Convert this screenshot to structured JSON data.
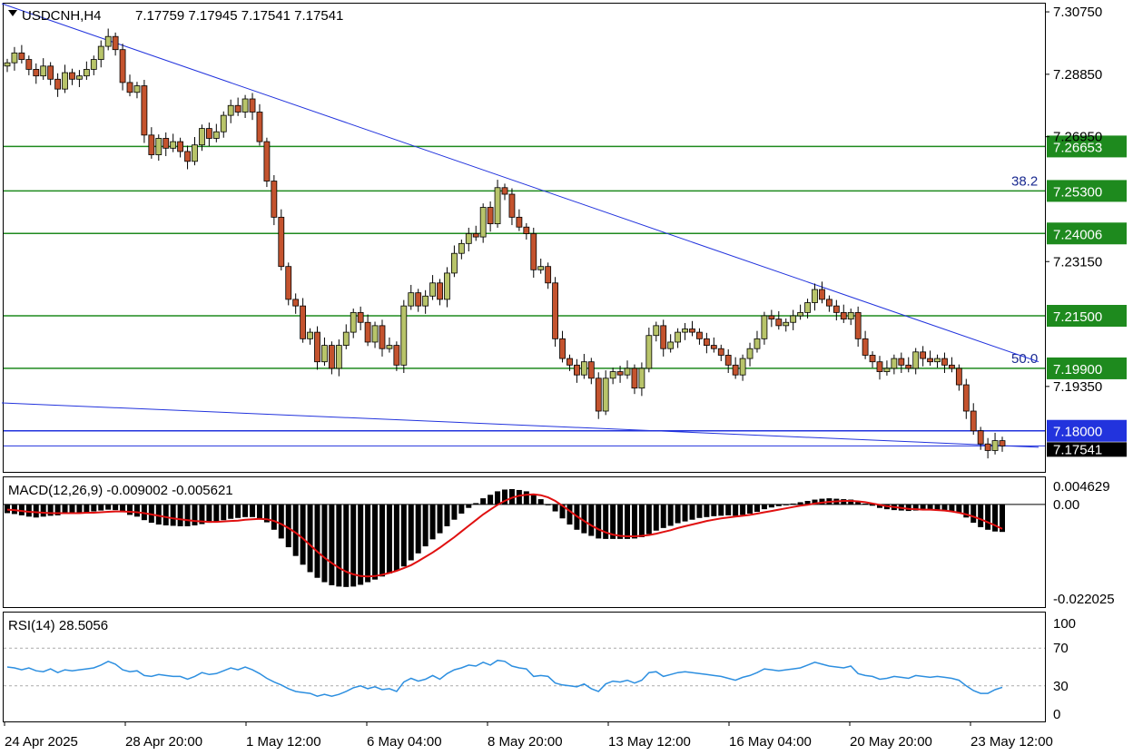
{
  "header": {
    "symbol_label": "USDCNH,H4",
    "ohlc": "7.17759 7.17945 7.17541 7.17541",
    "colors": {
      "bull": "#b8c46a",
      "bear": "#c4532e",
      "level": "#1e8a1e",
      "trend": "#2233dd",
      "macd_signal": "#e01010",
      "rsi": "#2d8fe0"
    }
  },
  "chart_data": [
    {
      "type": "candlestick",
      "title": "USDCNH,H4",
      "ylim": [
        7.1675,
        7.31
      ],
      "y_ticks": [
        "7.30750",
        "7.28850",
        "7.26950",
        "7.23150",
        "7.19350"
      ],
      "x_ticks": [
        "24 Apr 2025",
        "28 Apr 20:00",
        "1 May 12:00",
        "6 May 04:00",
        "8 May 20:00",
        "13 May 12:00",
        "16 May 04:00",
        "20 May 20:00",
        "23 May 12:00"
      ],
      "price_tag": "7.17541",
      "levels": [
        {
          "value": 7.26653,
          "label": "7.26653"
        },
        {
          "value": 7.253,
          "label": "7.25300",
          "fib": "38.2"
        },
        {
          "value": 7.24006,
          "label": "7.24006"
        },
        {
          "value": 7.215,
          "label": "7.21500"
        },
        {
          "value": 7.199,
          "label": "7.19900",
          "fib": "50.0"
        },
        {
          "value": 7.18,
          "label": "7.18000"
        }
      ],
      "trendlines": [
        {
          "from": [
            0,
            7.31
          ],
          "to": [
            138,
            7.201
          ]
        },
        {
          "from": [
            0,
            7.1885
          ],
          "to": [
            138,
            7.175
          ]
        }
      ],
      "candles_close": [
        7.292,
        7.295,
        7.293,
        7.29,
        7.288,
        7.291,
        7.287,
        7.284,
        7.289,
        7.287,
        7.288,
        7.29,
        7.293,
        7.297,
        7.3,
        7.296,
        7.286,
        7.283,
        7.285,
        7.27,
        7.264,
        7.269,
        7.266,
        7.268,
        7.265,
        7.262,
        7.267,
        7.272,
        7.269,
        7.271,
        7.276,
        7.279,
        7.277,
        7.281,
        7.277,
        7.268,
        7.256,
        7.245,
        7.23,
        7.22,
        7.218,
        7.208,
        7.21,
        7.201,
        7.206,
        7.199,
        7.206,
        7.21,
        7.216,
        7.213,
        7.207,
        7.212,
        7.205,
        7.206,
        7.2,
        7.218,
        7.222,
        7.218,
        7.221,
        7.225,
        7.22,
        7.228,
        7.234,
        7.237,
        7.24,
        7.239,
        7.248,
        7.243,
        7.254,
        7.252,
        7.245,
        7.242,
        7.24,
        7.229,
        7.23,
        7.225,
        7.208,
        7.202,
        7.2,
        7.197,
        7.201,
        7.196,
        7.186,
        7.196,
        7.198,
        7.197,
        7.199,
        7.193,
        7.199,
        7.209,
        7.212,
        7.205,
        7.207,
        7.21,
        7.211,
        7.21,
        7.208,
        7.206,
        7.205,
        7.203,
        7.2,
        7.197,
        7.202,
        7.205,
        7.208,
        7.215,
        7.214,
        7.212,
        7.213,
        7.215,
        7.216,
        7.219,
        7.223,
        7.22,
        7.218,
        7.216,
        7.214,
        7.216,
        7.208,
        7.203,
        7.201,
        7.198,
        7.199,
        7.202,
        7.2,
        7.199,
        7.204,
        7.202,
        7.201,
        7.202,
        7.2,
        7.199,
        7.194,
        7.186,
        7.18,
        7.176,
        7.174,
        7.177,
        7.1754
      ]
    },
    {
      "type": "bar",
      "title": "MACD(12,26,9) -0.009002 -0.005621",
      "ylim": [
        -0.0235,
        0.0062
      ],
      "y_ticks": [
        "0.004629",
        "0.00",
        "-0.022025"
      ],
      "series": [
        {
          "name": "MACD",
          "values": [
            -0.002,
            -0.0022,
            -0.0025,
            -0.0028,
            -0.003,
            -0.0028,
            -0.0026,
            -0.0025,
            -0.0022,
            -0.002,
            -0.0019,
            -0.0018,
            -0.0016,
            -0.0014,
            -0.0012,
            -0.0013,
            -0.0018,
            -0.0024,
            -0.0028,
            -0.0036,
            -0.0042,
            -0.0046,
            -0.0048,
            -0.0049,
            -0.005,
            -0.005,
            -0.0048,
            -0.0045,
            -0.0042,
            -0.0039,
            -0.0036,
            -0.0033,
            -0.0031,
            -0.0029,
            -0.0029,
            -0.0032,
            -0.0041,
            -0.0058,
            -0.0078,
            -0.0098,
            -0.0118,
            -0.0138,
            -0.0155,
            -0.0168,
            -0.0178,
            -0.0185,
            -0.0188,
            -0.0189,
            -0.0188,
            -0.0184,
            -0.0178,
            -0.0172,
            -0.0165,
            -0.0158,
            -0.0152,
            -0.0142,
            -0.0128,
            -0.0112,
            -0.0096,
            -0.008,
            -0.0066,
            -0.005,
            -0.0035,
            -0.0021,
            -0.0008,
            0.0003,
            0.0014,
            0.0022,
            0.003,
            0.0034,
            0.0035,
            0.0033,
            0.003,
            0.0022,
            0.0012,
            0.0,
            -0.0016,
            -0.0032,
            -0.0046,
            -0.0058,
            -0.0066,
            -0.0072,
            -0.0078,
            -0.0079,
            -0.0079,
            -0.0079,
            -0.0079,
            -0.0078,
            -0.0075,
            -0.0068,
            -0.006,
            -0.0054,
            -0.0049,
            -0.0043,
            -0.0039,
            -0.0035,
            -0.0031,
            -0.0029,
            -0.0027,
            -0.0026,
            -0.0025,
            -0.0026,
            -0.0024,
            -0.0021,
            -0.0017,
            -0.0011,
            -0.0007,
            -0.0004,
            -0.0001,
            0.0002,
            0.0005,
            0.0008,
            0.0011,
            0.0013,
            0.0014,
            0.0013,
            0.0012,
            0.0011,
            0.0007,
            0.0002,
            -0.0003,
            -0.0008,
            -0.0011,
            -0.0013,
            -0.0014,
            -0.0015,
            -0.0014,
            -0.0013,
            -0.0013,
            -0.0013,
            -0.0014,
            -0.0015,
            -0.002,
            -0.003,
            -0.0042,
            -0.0052,
            -0.0058,
            -0.0062,
            -0.0063
          ]
        },
        {
          "name": "Signal",
          "values": [
            -0.0012,
            -0.0013,
            -0.0015,
            -0.0017,
            -0.0018,
            -0.0019,
            -0.002,
            -0.002,
            -0.002,
            -0.002,
            -0.002,
            -0.0019,
            -0.0019,
            -0.0018,
            -0.0017,
            -0.0016,
            -0.0016,
            -0.0017,
            -0.0018,
            -0.002,
            -0.0023,
            -0.0026,
            -0.0029,
            -0.0032,
            -0.0034,
            -0.0036,
            -0.0038,
            -0.0039,
            -0.004,
            -0.004,
            -0.0039,
            -0.0038,
            -0.0037,
            -0.0035,
            -0.0034,
            -0.0033,
            -0.0034,
            -0.0038,
            -0.0045,
            -0.0054,
            -0.0065,
            -0.0078,
            -0.0093,
            -0.0108,
            -0.0122,
            -0.0134,
            -0.0145,
            -0.0154,
            -0.016,
            -0.0164,
            -0.0165,
            -0.0164,
            -0.0161,
            -0.0157,
            -0.0152,
            -0.0146,
            -0.0139,
            -0.013,
            -0.012,
            -0.011,
            -0.0099,
            -0.0087,
            -0.0075,
            -0.0062,
            -0.0049,
            -0.0036,
            -0.0023,
            -0.0012,
            -0.0001,
            0.0008,
            0.0015,
            0.002,
            0.0022,
            0.0023,
            0.0021,
            0.0016,
            0.0008,
            -0.0003,
            -0.0015,
            -0.0027,
            -0.0038,
            -0.0048,
            -0.0057,
            -0.0064,
            -0.0069,
            -0.0072,
            -0.0073,
            -0.0073,
            -0.0072,
            -0.007,
            -0.0067,
            -0.0063,
            -0.0059,
            -0.0054,
            -0.005,
            -0.0046,
            -0.0042,
            -0.0038,
            -0.0035,
            -0.0032,
            -0.003,
            -0.0028,
            -0.0026,
            -0.0024,
            -0.0021,
            -0.0018,
            -0.0015,
            -0.0012,
            -0.0009,
            -0.0006,
            -0.0003,
            -0.0001,
            0.0002,
            0.0004,
            0.0006,
            0.0007,
            0.0008,
            0.0008,
            0.0007,
            0.0005,
            0.0002,
            -0.0001,
            -0.0004,
            -0.0006,
            -0.0008,
            -0.001,
            -0.0011,
            -0.0012,
            -0.0012,
            -0.0013,
            -0.0014,
            -0.0016,
            -0.0019,
            -0.0023,
            -0.0028,
            -0.0034,
            -0.0041,
            -0.0048,
            -0.0056
          ]
        }
      ]
    },
    {
      "type": "line",
      "title": "RSI(14) 28.5056",
      "ylim": [
        0,
        100
      ],
      "y_ticks": [
        "100",
        "70",
        "30",
        "0"
      ],
      "levels": [
        70,
        30
      ],
      "series": [
        {
          "name": "RSI(14)",
          "values": [
            50,
            49,
            47,
            49,
            46,
            45,
            48,
            44,
            47,
            46,
            47,
            48,
            49,
            52,
            56,
            53,
            47,
            45,
            46,
            41,
            40,
            42,
            41,
            40,
            40,
            37,
            40,
            44,
            42,
            43,
            46,
            49,
            47,
            50,
            47,
            43,
            38,
            34,
            31,
            27,
            24,
            23,
            22,
            19,
            21,
            19,
            21,
            24,
            28,
            30,
            27,
            29,
            26,
            27,
            24,
            34,
            38,
            35,
            37,
            41,
            37,
            43,
            47,
            49,
            52,
            51,
            55,
            52,
            57,
            56,
            51,
            49,
            48,
            40,
            41,
            40,
            33,
            31,
            30,
            29,
            32,
            27,
            24,
            32,
            35,
            34,
            36,
            33,
            36,
            44,
            45,
            40,
            42,
            44,
            45,
            44,
            43,
            42,
            41,
            40,
            38,
            36,
            39,
            41,
            44,
            48,
            47,
            46,
            47,
            48,
            49,
            52,
            55,
            53,
            51,
            50,
            49,
            51,
            43,
            41,
            40,
            37,
            38,
            40,
            39,
            38,
            41,
            40,
            39,
            40,
            39,
            38,
            36,
            30,
            25,
            22,
            22,
            26,
            28.5
          ]
        }
      ]
    }
  ]
}
